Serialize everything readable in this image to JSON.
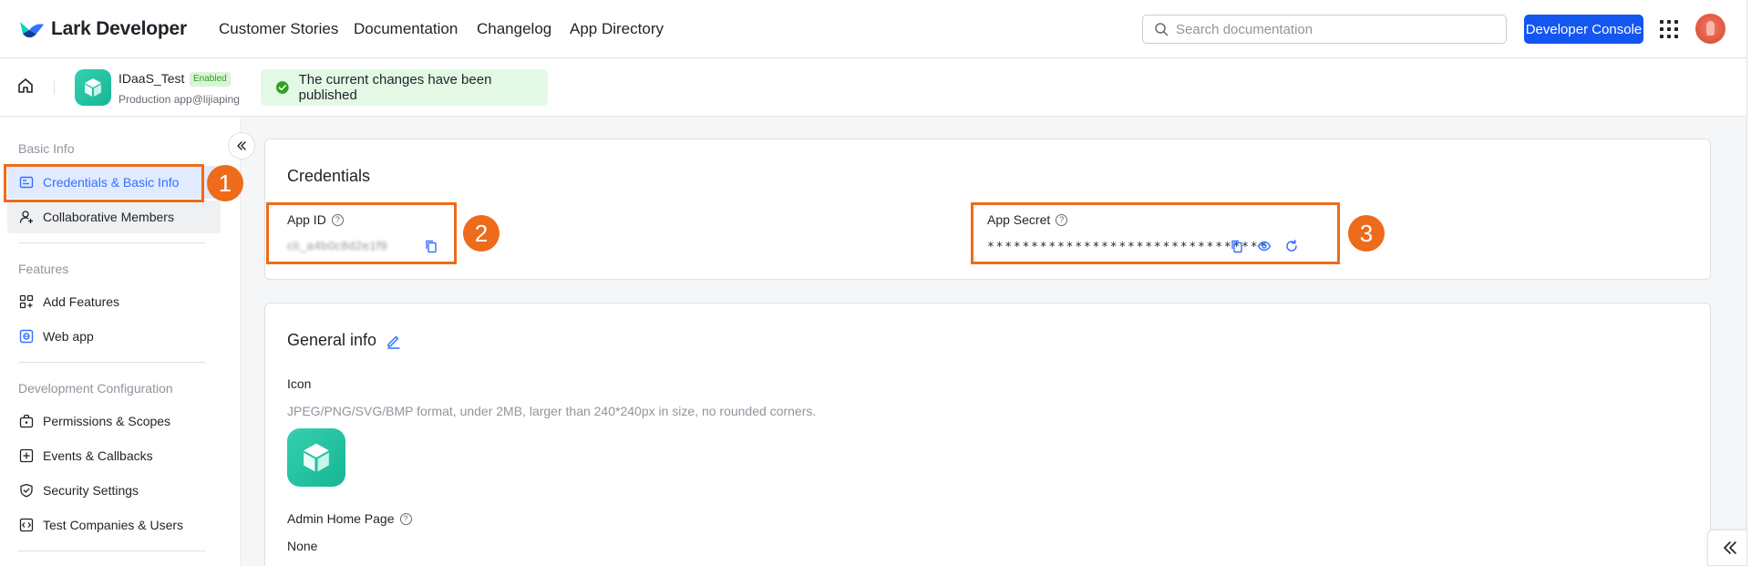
{
  "brand": {
    "name": "Lark Developer"
  },
  "nav": {
    "links": [
      "Customer Stories",
      "Documentation",
      "Changelog",
      "App Directory"
    ],
    "search_placeholder": "Search documentation",
    "console_label": "Developer Console"
  },
  "app": {
    "name": "IDaaS_Test",
    "status_badge": "Enabled",
    "subtitle": "Production app@lijiaping",
    "toast": "The current changes have been published"
  },
  "sidebar": {
    "sections": [
      {
        "title": "Basic Info",
        "items": [
          "Credentials & Basic Info",
          "Collaborative Members"
        ]
      },
      {
        "title": "Features",
        "items": [
          "Add Features",
          "Web app"
        ]
      },
      {
        "title": "Development Configuration",
        "items": [
          "Permissions & Scopes",
          "Events & Callbacks",
          "Security Settings",
          "Test Companies & Users"
        ]
      }
    ],
    "active_item": "Credentials & Basic Info"
  },
  "credentials": {
    "title": "Credentials",
    "app_id_label": "App ID",
    "app_id_value": "cli_a4b0c8d2e1f9",
    "app_secret_label": "App Secret",
    "app_secret_value": "********************************"
  },
  "general_info": {
    "title": "General info",
    "icon_label": "Icon",
    "icon_hint": "JPEG/PNG/SVG/BMP format, under 2MB, larger than 240*240px in size, no rounded corners.",
    "admin_home_label": "Admin Home Page",
    "admin_home_value": "None"
  },
  "annotations": [
    "1",
    "2",
    "3"
  ],
  "colors": {
    "primary": "#1456f0",
    "highlight": "#ed6b1b",
    "success": "#2ea121",
    "app_icon": "#20c29e"
  }
}
